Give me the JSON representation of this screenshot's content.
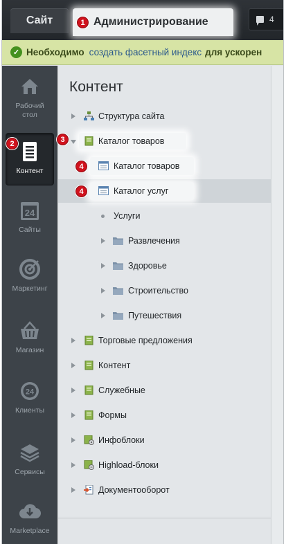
{
  "topbar": {
    "site_tab": "Сайт",
    "admin_tab": "Администрирование",
    "notifications_count": "4"
  },
  "notice": {
    "bold": "Необходимо",
    "link": "создать фасетный индекс",
    "rest": "для ускорен"
  },
  "leftmenu": [
    {
      "label": "Рабочий стол",
      "icon": "home-icon"
    },
    {
      "label": "Контент",
      "icon": "document-icon",
      "active": true
    },
    {
      "label": "Сайты",
      "icon": "calendar-24-icon"
    },
    {
      "label": "Маркетинг",
      "icon": "target-icon"
    },
    {
      "label": "Магазин",
      "icon": "basket-icon"
    },
    {
      "label": "Клиенты",
      "icon": "clients-24-icon"
    },
    {
      "label": "Сервисы",
      "icon": "layers-icon"
    },
    {
      "label": "Marketplace",
      "icon": "cloud-download-icon"
    }
  ],
  "content": {
    "title": "Контент",
    "tree": [
      {
        "label": "Структура сайта",
        "icon": "site-structure-icon"
      },
      {
        "label": "Каталог товаров",
        "icon": "infoblock-type-icon",
        "expanded": true
      },
      {
        "label": "Каталог товаров",
        "icon": "infoblock-icon"
      },
      {
        "label": "Каталог услуг",
        "icon": "infoblock-icon",
        "highlighted": true
      },
      {
        "label": "Услуги"
      },
      {
        "label": "Развлечения",
        "icon": "folder-icon"
      },
      {
        "label": "Здоровье",
        "icon": "folder-icon"
      },
      {
        "label": "Строительство",
        "icon": "folder-icon"
      },
      {
        "label": "Путешествия",
        "icon": "folder-icon"
      },
      {
        "label": "Торговые предложения",
        "icon": "infoblock-type-icon"
      },
      {
        "label": "Контент",
        "icon": "infoblock-type-icon"
      },
      {
        "label": "Служебные",
        "icon": "infoblock-type-icon"
      },
      {
        "label": "Формы",
        "icon": "infoblock-type-icon"
      },
      {
        "label": "Инфоблоки",
        "icon": "infoblock-settings-icon"
      },
      {
        "label": "Highload-блоки",
        "icon": "highload-icon"
      },
      {
        "label": "Документооборот",
        "icon": "workflow-icon"
      }
    ]
  },
  "badges": [
    "1",
    "2",
    "3",
    "4",
    "4"
  ],
  "colors": {
    "topbar": "#2a2e33",
    "notice_bg": "#d7e4a5",
    "left_menu": "#3d4349",
    "content_bg": "#e3e6e9",
    "badge": "#d0121d"
  }
}
